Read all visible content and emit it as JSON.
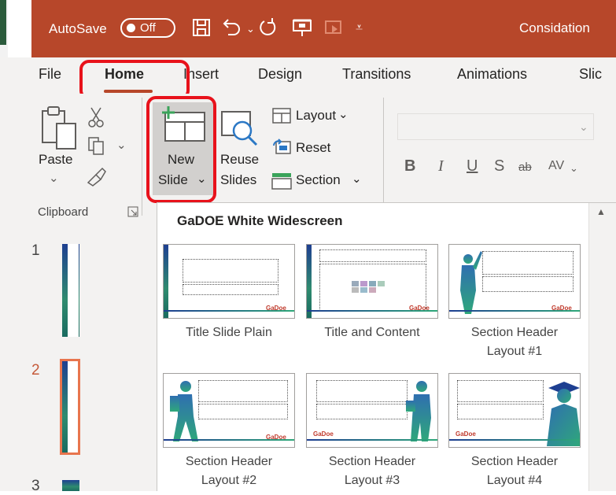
{
  "titlebar": {
    "autosave_label": "AutoSave",
    "autosave_state": "Off",
    "doc_title": "Considation",
    "colors": {
      "accent": "#b7472a",
      "highlight": "#e8121b"
    }
  },
  "tabs": {
    "file": "File",
    "home": "Home",
    "insert": "Insert",
    "design": "Design",
    "transitions": "Transitions",
    "animations": "Animations",
    "slideshow_partial": "Slic"
  },
  "ribbon": {
    "paste": "Paste",
    "clipboard_group": "Clipboard",
    "new_slide_top": "New",
    "new_slide_bottom": "Slide",
    "reuse_top": "Reuse",
    "reuse_bottom": "Slides",
    "layout": "Layout",
    "reset": "Reset",
    "section": "Section",
    "bold": "B",
    "italic": "I",
    "underline": "U",
    "shadow": "S",
    "strike": "ab",
    "spacing": "AV"
  },
  "slides_pane": {
    "numbers": [
      "1",
      "2",
      "3"
    ]
  },
  "gallery": {
    "title": "GaDOE White Widescreen",
    "layouts": [
      {
        "label_line1": "Title Slide Plain",
        "label_line2": ""
      },
      {
        "label_line1": "Title and Content",
        "label_line2": ""
      },
      {
        "label_line1": "Section Header",
        "label_line2": "Layout #1"
      },
      {
        "label_line1": "Section Header",
        "label_line2": "Layout #2"
      },
      {
        "label_line1": "Section Header",
        "label_line2": "Layout #3"
      },
      {
        "label_line1": "Section Header",
        "label_line2": "Layout #4"
      }
    ],
    "thumb_logo": "GaDoe"
  }
}
